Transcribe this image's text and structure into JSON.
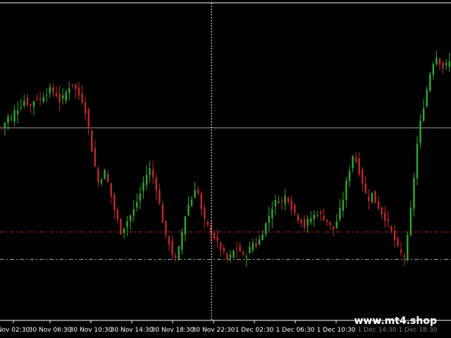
{
  "chart_data": {
    "type": "candlestick",
    "x_ticks": [
      {
        "label": "Nov 02:30",
        "faded": false
      },
      {
        "label": "30 Nov 06:30",
        "faded": false
      },
      {
        "label": "30 Nov 10:30",
        "faded": false
      },
      {
        "label": "30 Nov 14:30",
        "faded": false
      },
      {
        "label": "30 Nov 18:30",
        "faded": false
      },
      {
        "label": "30 Nov 22:30",
        "faded": false
      },
      {
        "label": "1 Dec 02:30",
        "faded": false
      },
      {
        "label": "1 Dec 06:30",
        "faded": false
      },
      {
        "label": "1 Dec 10:30",
        "faded": false
      },
      {
        "label": "1 Dec 14:30",
        "faded": true
      },
      {
        "label": "1 Dec 18:30",
        "faded": true
      }
    ],
    "y_range": [
      0,
      100
    ],
    "close_path": [
      60,
      62,
      64,
      63,
      66,
      67,
      68,
      70,
      69,
      68,
      70,
      71,
      70,
      72,
      73,
      74,
      73,
      72,
      70,
      71,
      73,
      75,
      76,
      74,
      72,
      70,
      66,
      60,
      52,
      46,
      40,
      42,
      44,
      40,
      35,
      30,
      26,
      22,
      24,
      26,
      28,
      30,
      33,
      36,
      40,
      43,
      45,
      42,
      38,
      32,
      26,
      20,
      18,
      14,
      12,
      16,
      22,
      28,
      32,
      34,
      38,
      36,
      30,
      26,
      24,
      22,
      20,
      18,
      16,
      14,
      12,
      13,
      15,
      16,
      15,
      13,
      14,
      16,
      18,
      17,
      19,
      22,
      25,
      28,
      31,
      33,
      34,
      33,
      35,
      34,
      31,
      29,
      27,
      26,
      24,
      26,
      27,
      28,
      29,
      28,
      27,
      26,
      24,
      23,
      26,
      30,
      34,
      40,
      45,
      50,
      48,
      44,
      40,
      36,
      34,
      36,
      33,
      31,
      29,
      27,
      25,
      22,
      19,
      16,
      14,
      13,
      20,
      30,
      42,
      54,
      62,
      68,
      74,
      80,
      84,
      86,
      84,
      82,
      83,
      84
    ],
    "horizontal_lines": [
      {
        "name": "resistance-level",
        "value": 60,
        "style": "solid",
        "color": "#9a9a9a"
      },
      {
        "name": "support-level-upper",
        "value": 22,
        "style": "dashdot",
        "color": "#b22222"
      },
      {
        "name": "support-level-lower",
        "value": 12,
        "style": "dashdot",
        "color": "#8fbc8f"
      }
    ],
    "crosshair_x_fraction": 0.469,
    "colors": {
      "bull": "#2eaa2e",
      "bear": "#c0282d",
      "background": "#000000",
      "axis": "#ffffff"
    }
  },
  "watermark": "www.mt4.shop"
}
